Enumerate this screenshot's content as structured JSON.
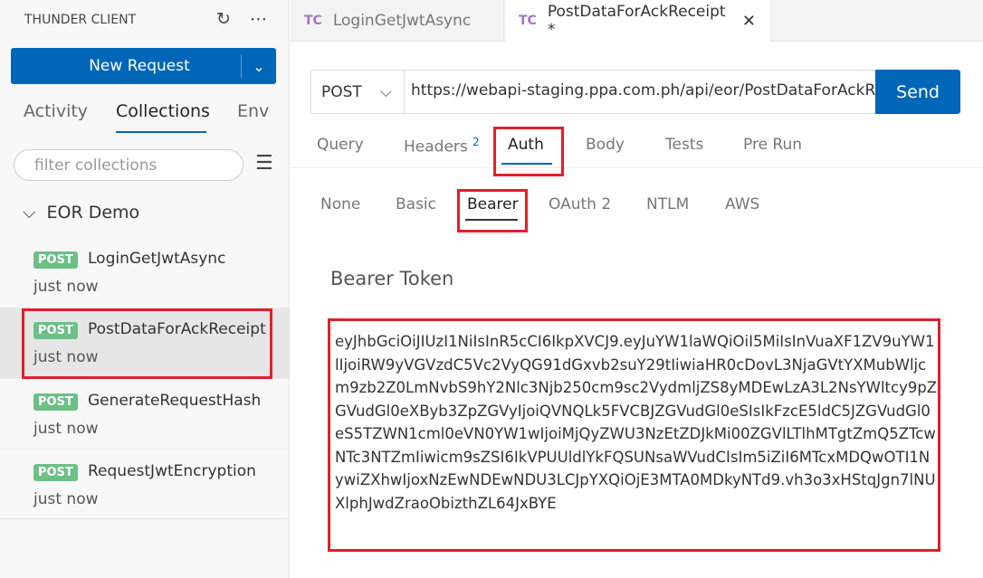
{
  "sidebar": {
    "title": "THUNDER CLIENT",
    "new_request": "New Request",
    "tabs": [
      {
        "label": "Activity"
      },
      {
        "label": "Collections",
        "active": true
      },
      {
        "label": "Env"
      }
    ],
    "filter_placeholder": "filter collections",
    "collection": "EOR Demo",
    "items": [
      {
        "method": "POST",
        "name": "LoginGetJwtAsync",
        "time": "just now"
      },
      {
        "method": "POST",
        "name": "PostDataForAckReceipt",
        "time": "just now",
        "selected": true
      },
      {
        "method": "POST",
        "name": "GenerateRequestHash",
        "time": "just now"
      },
      {
        "method": "POST",
        "name": "RequestJwtEncryption",
        "time": "just now"
      }
    ]
  },
  "editor_tabs": [
    {
      "icon": "TC",
      "label": "LoginGetJwtAsync"
    },
    {
      "icon": "TC",
      "label": "PostDataForAckReceipt *",
      "active": true
    }
  ],
  "request": {
    "method": "POST",
    "url": "https://webapi-staging.ppa.com.ph/api/eor/PostDataForAckReceipt",
    "send": "Send",
    "tabs": [
      {
        "label": "Query"
      },
      {
        "label": "Headers",
        "count": "2"
      },
      {
        "label": "Auth",
        "active": true
      },
      {
        "label": "Body"
      },
      {
        "label": "Tests"
      },
      {
        "label": "Pre Run"
      }
    ]
  },
  "auth": {
    "types": [
      {
        "label": "None"
      },
      {
        "label": "Basic"
      },
      {
        "label": "Bearer",
        "active": true
      },
      {
        "label": "OAuth 2"
      },
      {
        "label": "NTLM"
      },
      {
        "label": "AWS"
      }
    ],
    "token_label": "Bearer Token",
    "token": "eyJhbGciOiJIUzI1NiIsInR5cCI6IkpXVCJ9.eyJuYW1laWQiOiI5MiIsInVuaXF1ZV9uYW1lIjoiRW9yVGVzdC5Vc2VyQG91dGxvb2suY29tIiwiaHR0cDovL3NjaGVtYXMubWljcm9zb2Z0LmNvbS9hY2Nlc3Njb250cm9sc2VydmljZS8yMDEwLzA3L2NsYWltcy9pZGVudGl0eXByb3ZpZGVyIjoiQVNQLk5FVCBJZGVudGl0eSIsIkFzcE5ldC5JZGVudGl0eS5TZWN1cml0eVN0YW1wIjoiMjQyZWU3NzEtZDJkMi00ZGVlLTlhMTgtZmQ5ZTcwNTc3NTZmIiwicm9sZSI6IkVPUUldlYkFQSUNsaWVudCIsIm5iZiI6MTcxMDQwOTI1NywiZXhwIjoxNzEwNDEwNDU3LCJpYXQiOjE3MTA0MDkyNTd9.vh3o3xHStqJgn7lNUXlphJwdZraoObizthZL64JxBYE"
  },
  "colors": {
    "accent": "#0066b8",
    "post_badge": "#6cc085",
    "highlight": "#e0202a",
    "tc_icon": "#a074c4"
  }
}
